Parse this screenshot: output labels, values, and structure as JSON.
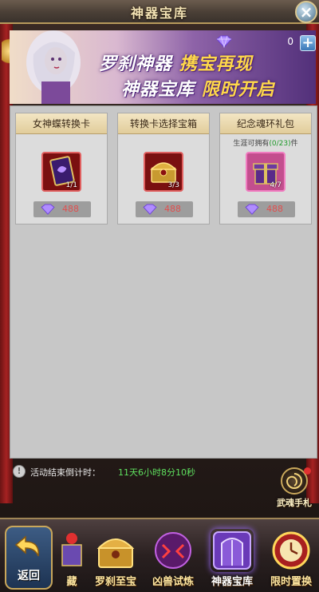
{
  "window": {
    "title": "神器宝库"
  },
  "banner": {
    "line1_a": "罗刹神器",
    "line1_b": "携宝再现",
    "line2_a": "神器宝库",
    "line2_b": "限时开启",
    "currency_value": "0",
    "add_label": "+"
  },
  "cards": [
    {
      "title": "女神蝶转换卡",
      "note_prefix": "",
      "note_count": "",
      "note_suffix": "",
      "count": "1/1",
      "price": "488",
      "item_icon": "butterfly-card-icon"
    },
    {
      "title": "转换卡选择宝箱",
      "note_prefix": "",
      "note_count": "",
      "note_suffix": "",
      "count": "3/3",
      "price": "488",
      "item_icon": "treasure-chest-icon"
    },
    {
      "title": "纪念魂环礼包",
      "note_prefix": "生涯可拥有",
      "note_count": "(0/23)",
      "note_suffix": "件",
      "count": "4/7",
      "price": "488",
      "item_icon": "gift-box-icon"
    }
  ],
  "countdown": {
    "label": "活动结束倒计时：",
    "value": "11天6小时8分10秒"
  },
  "side_shortcut": {
    "label": "武魂手札"
  },
  "bottom_nav": {
    "back_label": "返回",
    "items": [
      {
        "label": "藏"
      },
      {
        "label": "罗刹至宝"
      },
      {
        "label": "凶兽试炼"
      },
      {
        "label": "神器宝库",
        "active": true
      },
      {
        "label": "限时置换"
      }
    ]
  },
  "colors": {
    "accent_gold": "#c9a75b",
    "price_red": "#e05050",
    "countdown_green": "#5fe05f",
    "panel_gray": "#c7c7c7"
  }
}
